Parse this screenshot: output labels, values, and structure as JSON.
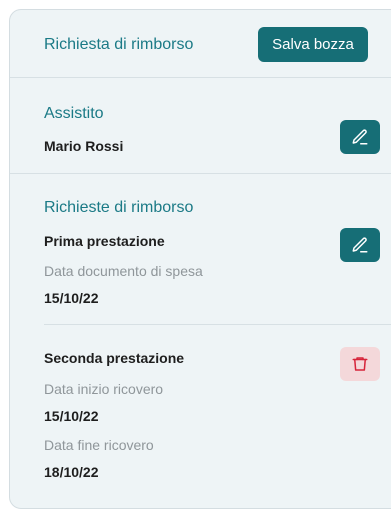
{
  "header": {
    "title": "Richiesta di rimborso",
    "save_label": "Salva bozza"
  },
  "assistito": {
    "title": "Assistito",
    "name": "Mario Rossi",
    "edit_icon": "pencil-icon"
  },
  "richieste": {
    "title": "Richieste di rimborso",
    "first": {
      "name": "Prima prestazione",
      "date_label": "Data documento di spesa",
      "date_value": "15/10/22",
      "edit_icon": "pencil-icon"
    },
    "second": {
      "name": "Seconda prestazione",
      "start_label": "Data inizio ricovero",
      "start_value": "15/10/22",
      "end_label": "Data fine ricovero",
      "end_value": "18/10/22",
      "delete_icon": "trash-icon"
    }
  },
  "colors": {
    "accent": "#1b7a86",
    "button": "#166e76",
    "delete_bg": "#f4d8da",
    "delete_icon": "#d6243a",
    "panel_bg": "#eef4f6"
  }
}
